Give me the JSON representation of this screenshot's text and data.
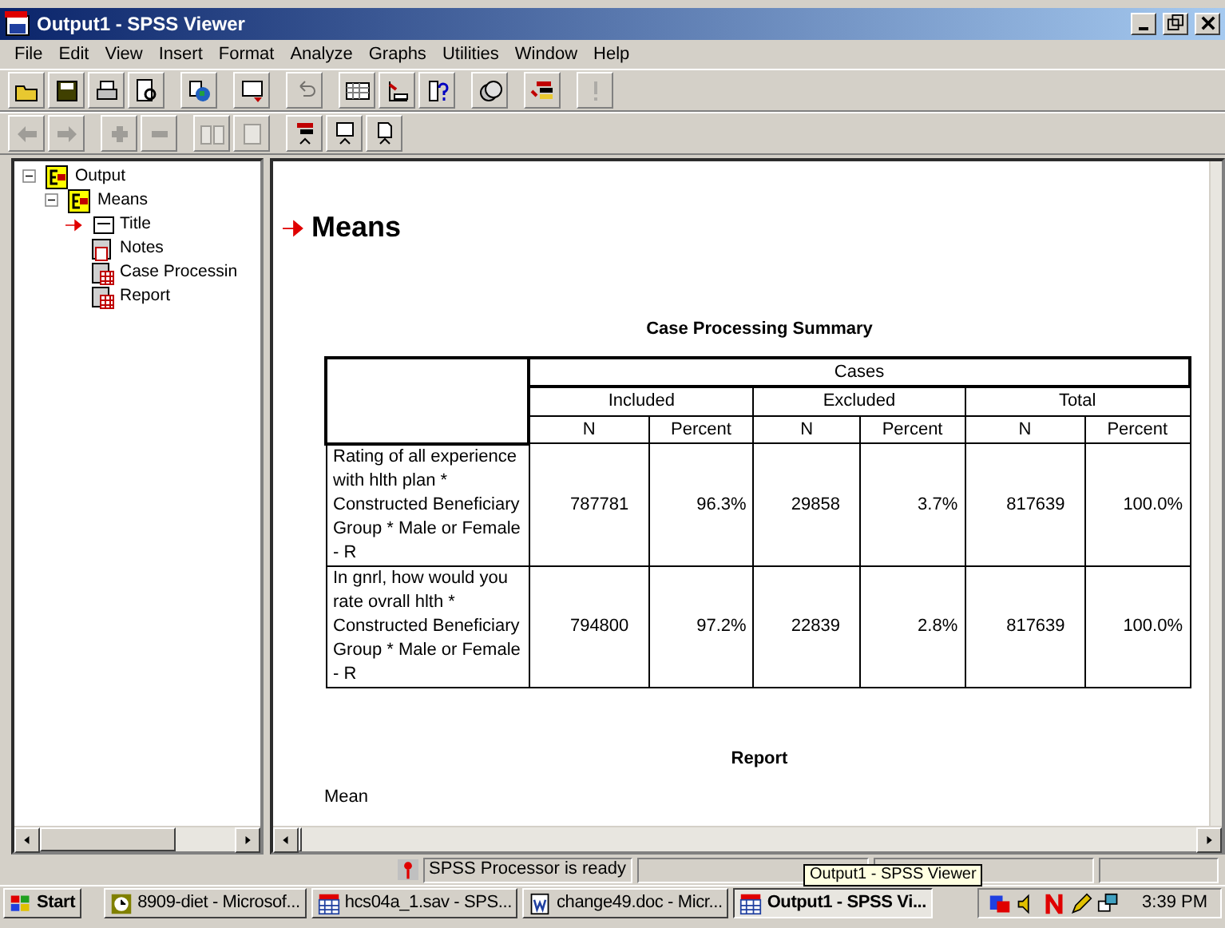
{
  "window": {
    "title": "Output1 - SPSS Viewer"
  },
  "menu": [
    "File",
    "Edit",
    "View",
    "Insert",
    "Format",
    "Analyze",
    "Graphs",
    "Utilities",
    "Window",
    "Help"
  ],
  "toolbar_1": [
    {
      "kind": "open",
      "disabled": false
    },
    {
      "kind": "save",
      "disabled": false
    },
    {
      "kind": "print",
      "disabled": false
    },
    {
      "kind": "preview",
      "disabled": false
    },
    {
      "kind": "globe",
      "disabled": false
    },
    {
      "kind": "dialog",
      "disabled": false
    },
    {
      "kind": "undo",
      "disabled": true
    },
    {
      "kind": "grid",
      "disabled": false
    },
    {
      "kind": "chart",
      "disabled": false
    },
    {
      "kind": "question",
      "disabled": false
    },
    {
      "kind": "circles",
      "disabled": false
    },
    {
      "kind": "list",
      "disabled": false
    },
    {
      "kind": "exclamation",
      "disabled": true
    }
  ],
  "toolbar_2": [
    {
      "kind": "back",
      "disabled": true
    },
    {
      "kind": "forward",
      "disabled": true
    },
    {
      "kind": "plus",
      "disabled": true
    },
    {
      "kind": "minus",
      "disabled": true
    },
    {
      "kind": "book",
      "disabled": true
    },
    {
      "kind": "page",
      "disabled": true
    },
    {
      "kind": "promote",
      "disabled": false
    },
    {
      "kind": "demote",
      "disabled": false
    },
    {
      "kind": "doc",
      "disabled": false
    }
  ],
  "outline": [
    {
      "label": "Output",
      "kind": "book",
      "expanded": true,
      "selected": false,
      "children": [
        {
          "label": "Means",
          "kind": "book",
          "expanded": true,
          "selected": false,
          "children": [
            {
              "label": "Title",
              "kind": "title",
              "selected": true
            },
            {
              "label": "Notes",
              "kind": "notes",
              "selected": false
            },
            {
              "label": "Case Processin",
              "kind": "table",
              "selected": false
            },
            {
              "label": "Report",
              "kind": "table",
              "selected": false
            }
          ]
        }
      ]
    }
  ],
  "content": {
    "heading": "Means",
    "heading_selected": true,
    "summary": {
      "title": "Case Processing Summary",
      "top_header": "Cases",
      "groups": [
        "Included",
        "Excluded",
        "Total"
      ],
      "subheaders": [
        "N",
        "Percent",
        "N",
        "Percent",
        "N",
        "Percent"
      ],
      "rows": [
        {
          "label": "Rating of all experience with hlth plan  * Constructed Beneficiary Group * Male or Female  - R",
          "cells": [
            "787781",
            "96.3%",
            "29858",
            "3.7%",
            "817639",
            "100.0%"
          ]
        },
        {
          "label": "In gnrl, how would you rate ovrall hlth  * Constructed Beneficiary Group * Male or Female  - R",
          "cells": [
            "794800",
            "97.2%",
            "22839",
            "2.8%",
            "817639",
            "100.0%"
          ]
        }
      ]
    },
    "report_title": "Report",
    "report_first_line": "Mean"
  },
  "status_bar": {
    "message": "SPSS Processor  is ready"
  },
  "taskbar": {
    "start": "Start",
    "items": [
      {
        "label": "8909-diet - Microsof...",
        "kind": "clock",
        "selected": false
      },
      {
        "label": "hcs04a_1.sav - SPS...",
        "kind": "spss",
        "selected": false
      },
      {
        "label": "change49.doc - Micr...",
        "kind": "word",
        "selected": false
      },
      {
        "label": "Output1 - SPSS Vi...",
        "kind": "spss",
        "selected": true
      }
    ],
    "tooltip": "Output1 - SPSS Viewer",
    "clock": "3:39 PM"
  }
}
